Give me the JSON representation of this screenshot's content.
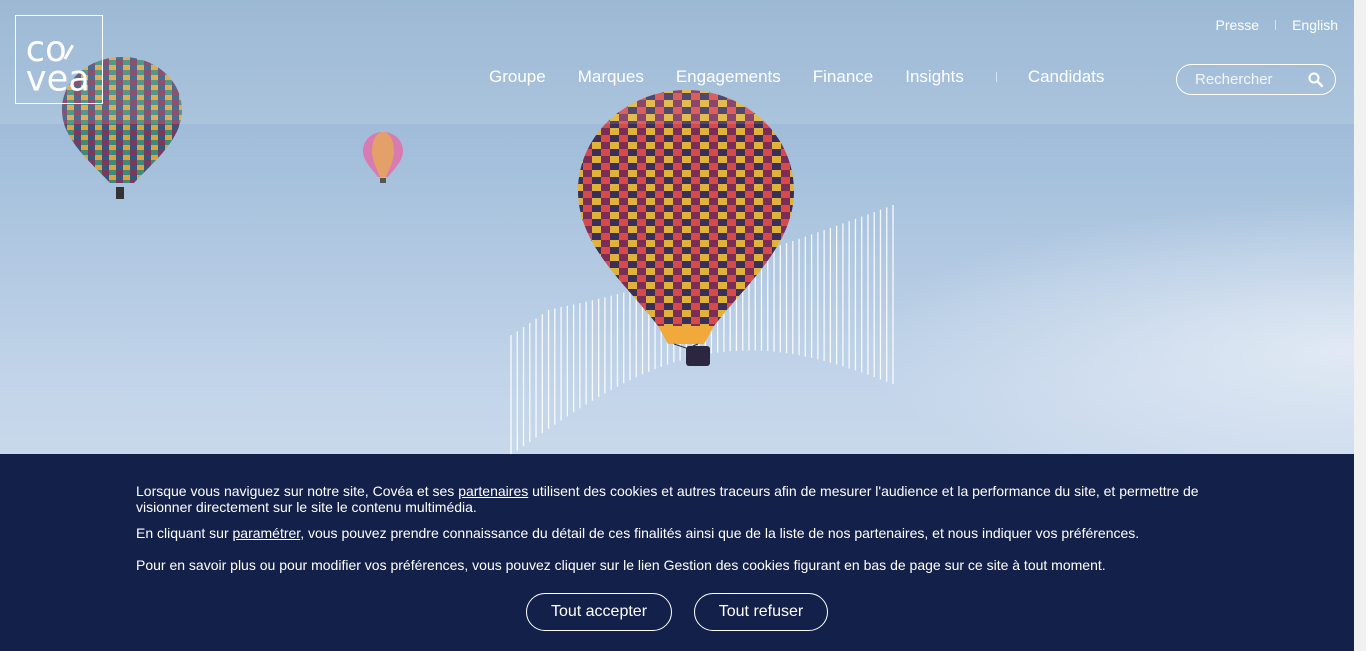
{
  "header": {
    "logo_alt": "Covéa",
    "top_links": [
      "Presse",
      "English"
    ],
    "nav": [
      "Groupe",
      "Marques",
      "Engagements",
      "Finance",
      "Insights",
      "Candidats"
    ],
    "search_placeholder": "Rechercher"
  },
  "cookie_banner": {
    "p1_before": "Lorsque vous naviguez sur notre site, Covéa et ses ",
    "p1_link": "partenaires",
    "p1_after": " utilisent des cookies et autres traceurs afin de mesurer l'audience et la performance du site, et permettre de visionner directement sur le site le contenu multimédia.",
    "p2_before": "En cliquant sur ",
    "p2_link": "paramétrer",
    "p2_after": ", vous pouvez prendre connaissance du détail de ces finalités ainsi que de la liste de nos partenaires, et nous indiquer vos préférences.",
    "p3": "Pour en savoir plus ou pour modifier vos préférences, vous pouvez cliquer sur le lien  Gestion des cookies figurant en bas de page sur ce site à tout moment.",
    "accept_label": "Tout accepter",
    "refuse_label": "Tout refuser"
  },
  "colors": {
    "banner_bg": "#13214a",
    "sky_top": "#8fb0cf",
    "sky_bottom": "#d9e3f0"
  }
}
